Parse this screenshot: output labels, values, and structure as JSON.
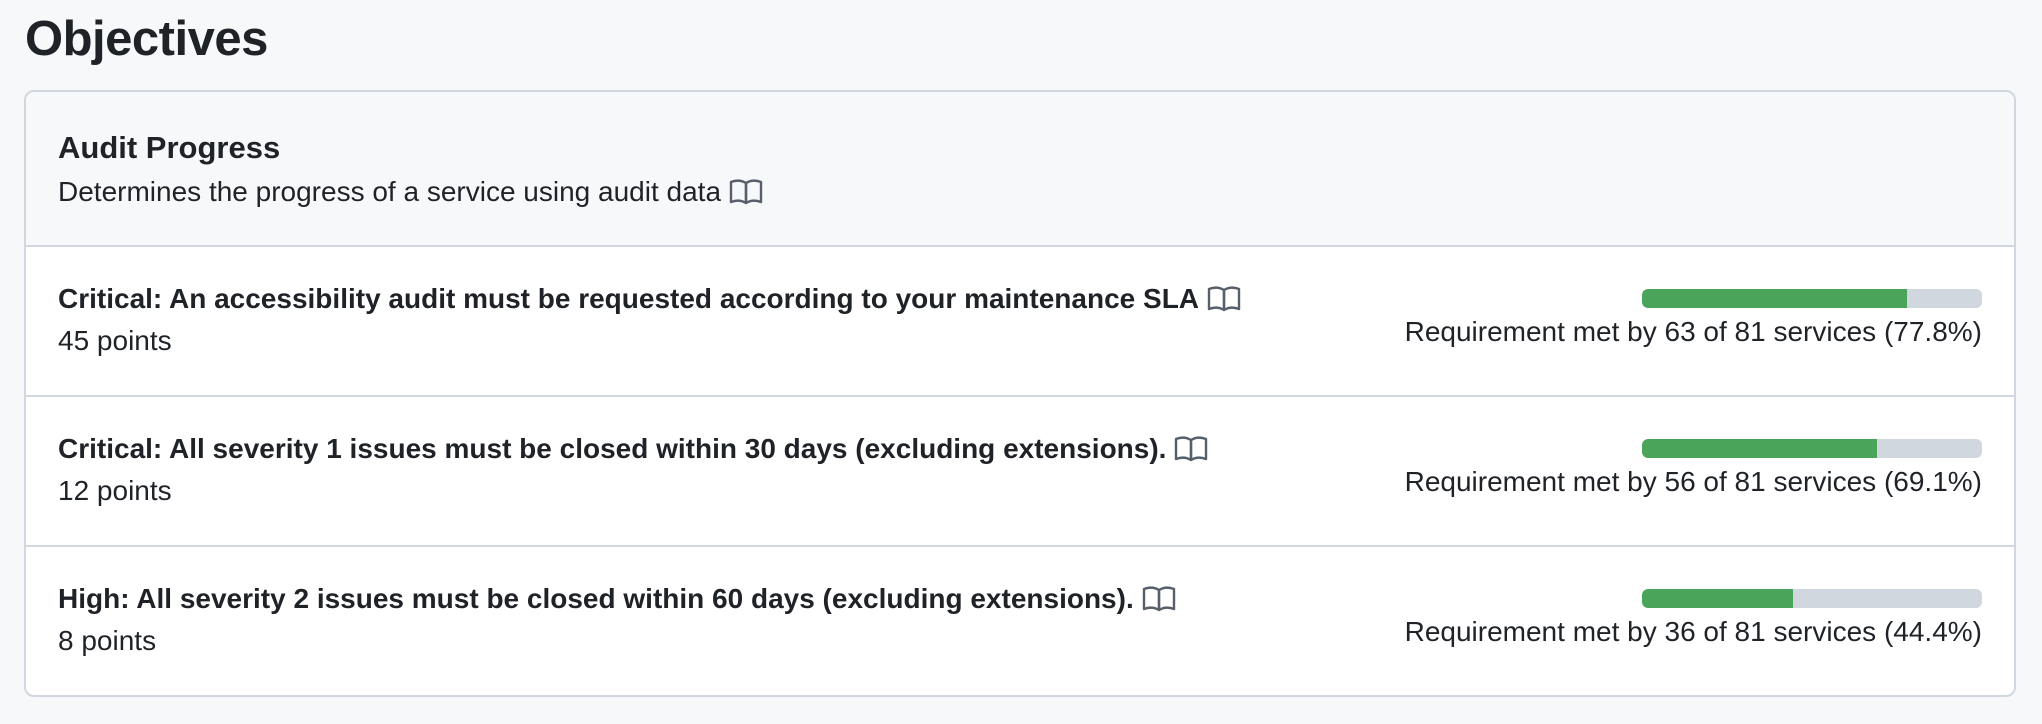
{
  "page": {
    "title": "Objectives"
  },
  "card": {
    "title": "Audit Progress",
    "description": "Determines the progress of a service using audit data",
    "description_icon": "book-icon"
  },
  "requirements": [
    {
      "title": "Critical: An accessibility audit must be requested according to your maintenance SLA",
      "icon": "book-icon",
      "points": "45 points",
      "progress_fraction": 0.778,
      "progress_text": "Requirement met by 63 of 81 services (77.8%)"
    },
    {
      "title": "Critical: All severity 1 issues must be closed within 30 days (excluding extensions).",
      "icon": "book-icon",
      "points": "12 points",
      "progress_fraction": 0.691,
      "progress_text": "Requirement met by 56 of 81 services (69.1%)"
    },
    {
      "title": "High: All severity 2 issues must be closed within 60 days (excluding extensions).",
      "icon": "book-icon",
      "points": "8 points",
      "progress_fraction": 0.444,
      "progress_text": "Requirement met by 36 of 81 services (44.4%)"
    }
  ],
  "colors": {
    "progress_fill": "#4aa55a",
    "progress_track": "#d0d7de",
    "border": "#d0d7de",
    "header_bg": "#f6f8fa"
  }
}
